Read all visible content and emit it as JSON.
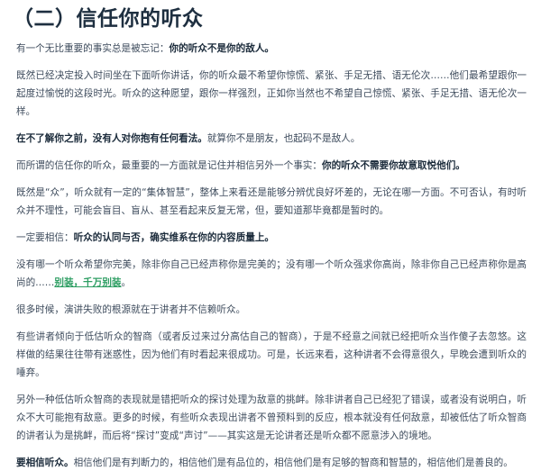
{
  "article": {
    "heading": "（二）信任你的听众",
    "p1": {
      "text": "有一个无比重要的事实总是被忘记：",
      "bold": "你的听众不是你的敌人。"
    },
    "p2": {
      "text": "既然已经决定投入时间坐在下面听你讲话，你的听众最不希望你惊慌、紧张、手足无措、语无伦次……他们最希望跟你一起度过愉悦的这段时光。听众的这种愿望，跟你一样强烈，正如你当然也不希望自己惊慌、紧张、手足无措、语无伦次一样。"
    },
    "p3": {
      "bold": "在不了解你之前，没有人对你抱有任何看法。",
      "text": "就算你不是朋友，也起码不是敌人。"
    },
    "p4": {
      "text": "而所谓的信任你的听众，最重要的一方面就是记住并相信另外一个事实：",
      "bold": "你的听众不需要你故意取悦他们。"
    },
    "p5": {
      "text": "既然是“众”，听众就有一定的“集体智慧”，整体上来看还是能够分辨优良好坏差的，无论在哪一方面。不可否认，有时听众并不理性，可能会盲目、盲从、甚至看起来反复无常，但，要知道那毕竟都是暂时的。"
    },
    "p6": {
      "text": "一定要相信：",
      "bold": "听众的认同与否，确实维系在你的内容质量上。"
    },
    "p7": {
      "text": "没有哪一个听众希望你完美，除非你自己已经声称你是完美的；没有哪一个听众强求你高尚，除非你自己已经声称你是高尚的……",
      "link": "别装，千万别装",
      "end": "。"
    },
    "p8": {
      "text": "很多时候，演讲失败的根源就在于讲者并不信赖听众。"
    },
    "p9": {
      "text": "有些讲者倾向于低估听众的智商（或者反过来过分高估自己的智商），于是不经意之间就已经把听众当作傻子去忽悠。这样做的结果往往带有迷惑性，因为他们有时看起来很成功。可是，长远来看，这种讲者不会得意很久，早晚会遭到听众的唾弃。"
    },
    "p10": {
      "text": "另外一种低估听众智商的表现就是错把听众的探讨处理为敌意的挑衅。除非讲者自己已经犯了错误，或者没有说明白，听众不大可能抱有敌意。更多的时候，有些听众表现出讲者不曾预料到的反应，根本就没有任何敌意，却被低估了听众智商的讲者认为是挑衅，而后将“探讨”变成“声讨”——其实这是无论讲者还是听众都不愿意涉入的境地。"
    },
    "p11": {
      "bold": "要相信听众。",
      "text": "相信他们是有判断力的，相信他们是有品位的，相信他们是有足够的智商和智慧的，相信他们是善良的。"
    }
  }
}
